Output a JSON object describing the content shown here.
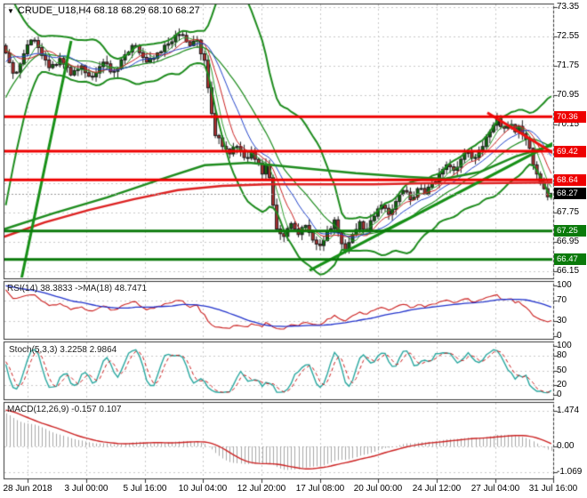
{
  "header": {
    "dropdown_icon": "▼",
    "symbol_period": "CRUDE_U18,H4",
    "ohlc": "68.18 68.29 68.10 68.27"
  },
  "colors": {
    "bull": "#0b6e0b",
    "bear": "#b03030",
    "wick": "#1c1c1c",
    "band": "#1e8c1e",
    "ma_fast_green": "#2f9e2f",
    "ma_fast_red": "#cc2222",
    "ma_fast_blue": "#2244cc",
    "ma_slow_green": "#1e8c1e",
    "ma_slow_red": "#dd2222",
    "level_res": "#ee0000",
    "level_sup": "#0a7a0a",
    "trend_green": "#179017",
    "trend_red": "#ee1111",
    "grid": "#c9c9c9",
    "border": "#333333",
    "rsi": "#cc2222",
    "rsi_ma": "#2233cc",
    "stoch_k": "#2aa8a0",
    "stoch_d": "#cc2222",
    "macd_hist": "#a9a9a9",
    "macd_sig": "#cc2222",
    "badge_res": "#ee0000",
    "badge_sup": "#0a7a0a",
    "badge_cur": "#000000",
    "current_dash": "#999999"
  },
  "chart_data": {
    "type": "candlestick",
    "symbol": "CRUDE_U18,H4",
    "title": "CRUDE_U18,H4 68.18 68.29 68.10 68.27",
    "y_axis": {
      "ticks": [
        73.35,
        72.55,
        71.75,
        70.95,
        70.15,
        69.35,
        68.55,
        67.75,
        66.95,
        66.15
      ],
      "ylim": [
        66.15,
        73.35
      ]
    },
    "x_axis": {
      "labels": [
        "28 Jun 2018",
        "3 Jul 00:00",
        "5 Jul 16:00",
        "10 Jul 04:00",
        "12 Jul 20:00",
        "17 Jul 08:00",
        "20 Jul 00:00",
        "24 Jul 12:00",
        "27 Jul 04:00",
        "31 Jul 16:00"
      ]
    },
    "candles": {
      "bars_total": 152,
      "seed": 20180731,
      "warmup": {
        "bars": 34,
        "path": [
          [
            0,
            65.2
          ],
          [
            13,
            67.0
          ],
          [
            25,
            71.9
          ],
          [
            33,
            72.3
          ]
        ]
      },
      "keypoints": [
        [
          0,
          72.1
        ],
        [
          2,
          71.55
        ],
        [
          4,
          71.8
        ],
        [
          7,
          72.45
        ],
        [
          9,
          72.25
        ],
        [
          12,
          71.7
        ],
        [
          15,
          71.95
        ],
        [
          18,
          71.5
        ],
        [
          21,
          71.75
        ],
        [
          24,
          71.45
        ],
        [
          27,
          71.85
        ],
        [
          30,
          71.6
        ],
        [
          33,
          72.05
        ],
        [
          36,
          72.3
        ],
        [
          39,
          71.85
        ],
        [
          42,
          72.1
        ],
        [
          45,
          72.35
        ],
        [
          48,
          72.6
        ],
        [
          51,
          72.3
        ],
        [
          53,
          72.45
        ],
        [
          55,
          71.9
        ],
        [
          56,
          71.15
        ],
        [
          57,
          70.45
        ],
        [
          58,
          69.85
        ],
        [
          60,
          69.55
        ],
        [
          62,
          69.35
        ],
        [
          64,
          69.55
        ],
        [
          66,
          69.25
        ],
        [
          68,
          69.4
        ],
        [
          70,
          69.1
        ],
        [
          71,
          68.8
        ],
        [
          72,
          69.05
        ],
        [
          73,
          68.7
        ],
        [
          74,
          67.95
        ],
        [
          75,
          67.3
        ],
        [
          77,
          67.1
        ],
        [
          79,
          67.45
        ],
        [
          81,
          67.15
        ],
        [
          83,
          67.4
        ],
        [
          85,
          67.0
        ],
        [
          87,
          66.85
        ],
        [
          89,
          67.25
        ],
        [
          91,
          67.55
        ],
        [
          92,
          67.2
        ],
        [
          93,
          66.9
        ],
        [
          94,
          66.7
        ],
        [
          96,
          67.15
        ],
        [
          98,
          67.5
        ],
        [
          100,
          67.25
        ],
        [
          102,
          67.65
        ],
        [
          104,
          67.95
        ],
        [
          106,
          67.7
        ],
        [
          108,
          68.05
        ],
        [
          110,
          68.35
        ],
        [
          112,
          68.1
        ],
        [
          114,
          68.4
        ],
        [
          116,
          68.25
        ],
        [
          118,
          68.55
        ],
        [
          120,
          68.8
        ],
        [
          122,
          69.05
        ],
        [
          124,
          68.9
        ],
        [
          126,
          69.2
        ],
        [
          128,
          69.4
        ],
        [
          130,
          69.25
        ],
        [
          132,
          69.55
        ],
        [
          134,
          69.95
        ],
        [
          136,
          70.3
        ],
        [
          138,
          70.05
        ],
        [
          140,
          70.15
        ],
        [
          141,
          69.95
        ],
        [
          142,
          70.1
        ],
        [
          143,
          69.9
        ],
        [
          144,
          69.75
        ],
        [
          145,
          69.5
        ],
        [
          146,
          69.05
        ],
        [
          147,
          68.8
        ],
        [
          148,
          68.55
        ],
        [
          149,
          68.4
        ],
        [
          150,
          68.18
        ],
        [
          151,
          68.27
        ]
      ],
      "last_bar": {
        "open": 68.18,
        "high": 68.29,
        "low": 68.1,
        "close": 68.27
      }
    },
    "levels": {
      "resistance": [
        70.36,
        69.42,
        68.64
      ],
      "support": [
        67.25,
        66.47
      ],
      "current": 68.27
    },
    "trendlines": [
      {
        "name": "steep-uptrend",
        "color": "up",
        "points": [
          [
            24,
            65.93
          ],
          [
            80,
            72.43
          ]
        ]
      },
      {
        "name": "channel-uptrend",
        "color": "up",
        "points": [
          [
            348,
            66.17
          ],
          [
            622,
            69.64
          ]
        ]
      },
      {
        "name": "downtrend",
        "color": "down",
        "points": [
          [
            548,
            70.47
          ],
          [
            622,
            69.37
          ]
        ]
      }
    ],
    "long_mas": [
      {
        "name": "slow-ma-green",
        "color": "green",
        "points": [
          [
            0,
            67.26
          ],
          [
            60,
            67.73
          ],
          [
            120,
            68.16
          ],
          [
            180,
            68.65
          ],
          [
            230,
            69.04
          ],
          [
            280,
            69.11
          ],
          [
            340,
            68.96
          ],
          [
            400,
            68.82
          ],
          [
            460,
            68.72
          ],
          [
            500,
            68.67
          ],
          [
            540,
            68.86
          ],
          [
            580,
            69.28
          ],
          [
            622,
            69.59
          ]
        ]
      },
      {
        "name": "slow-ma-red",
        "color": "red",
        "points": [
          [
            0,
            67.05
          ],
          [
            50,
            67.48
          ],
          [
            100,
            67.82
          ],
          [
            150,
            68.11
          ],
          [
            200,
            68.36
          ],
          [
            250,
            68.48
          ],
          [
            300,
            68.52
          ],
          [
            360,
            68.52
          ],
          [
            420,
            68.52
          ],
          [
            480,
            68.55
          ],
          [
            540,
            68.55
          ],
          [
            622,
            68.57
          ]
        ]
      }
    ],
    "indicators": {
      "rsi": {
        "label": "RSI(14) 38.3833  ->MA(18) 48.7471",
        "period": 14,
        "ma_period": 18,
        "value": 38.3833,
        "ma_value": 48.7471,
        "levels": [
          70,
          30
        ],
        "axis": [
          "100",
          "70",
          "30",
          "0"
        ]
      },
      "stoch": {
        "label": "Stoch(5,3,3) 3.2258 2.9864",
        "k": 5,
        "slow": 3,
        "d": 3,
        "value_k": 3.2258,
        "value_d": 2.9864,
        "levels": [
          80,
          50,
          20
        ],
        "axis": [
          "100",
          "80",
          "50",
          "20",
          "0"
        ]
      },
      "macd": {
        "label": "MACD(12,26,9) -0.157 0.107",
        "fast": 12,
        "slow": 26,
        "signal": 9,
        "value_main": -0.157,
        "value_signal": 0.107,
        "axis": [
          "1.474",
          "0.00",
          "-1.069"
        ],
        "axis_values": [
          1.474,
          0.0,
          -1.069
        ]
      }
    }
  }
}
